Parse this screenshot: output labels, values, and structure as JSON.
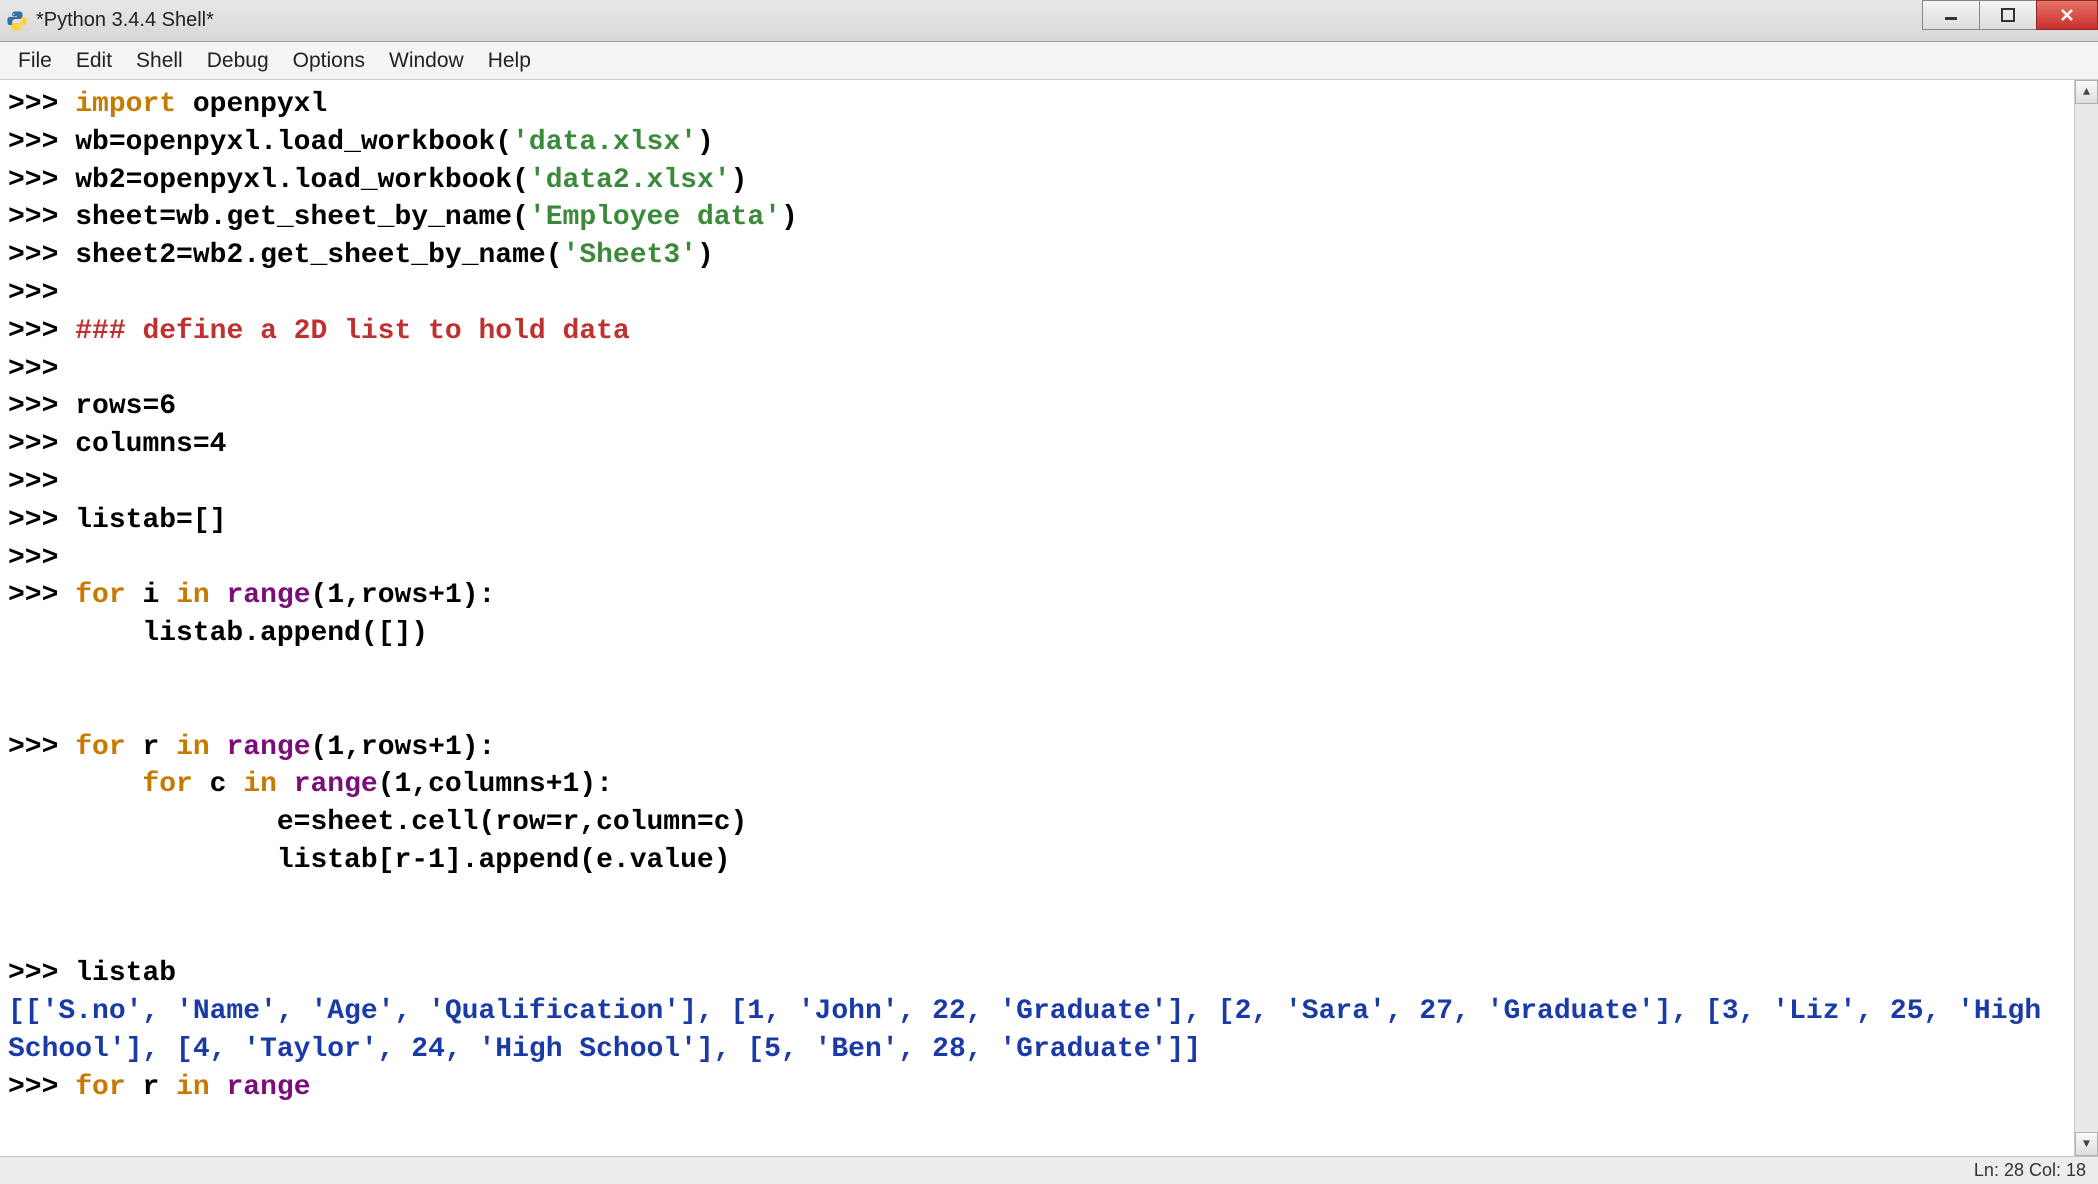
{
  "window": {
    "title": "*Python 3.4.4 Shell*"
  },
  "menu": {
    "file": "File",
    "edit": "Edit",
    "shell": "Shell",
    "debug": "Debug",
    "options": "Options",
    "window": "Window",
    "help": "Help"
  },
  "code": {
    "prompt": ">>>",
    "kw_import": "import",
    "l1_rest": " openpyxl",
    "l2": "wb=openpyxl.load_workbook(",
    "l2_str": "'data.xlsx'",
    "l2_end": ")",
    "l3": "wb2=openpyxl.load_workbook(",
    "l3_str": "'data2.xlsx'",
    "l3_end": ")",
    "l4": "sheet=wb.get_sheet_by_name(",
    "l4_str": "'Employee data'",
    "l4_end": ")",
    "l5": "sheet2=wb2.get_sheet_by_name(",
    "l5_str": "'Sheet3'",
    "l5_end": ")",
    "l7_cmt": "### define a 2D list to hold data",
    "l9": "rows=6",
    "l10": "columns=4",
    "l12": "listab=[]",
    "kw_for": "for",
    "kw_in": "in",
    "kw_range": "range",
    "l14_a": " i ",
    "l14_b": " ",
    "l14_c": "(1,rows+1):",
    "l15": "        listab.append([])",
    "l18_a": " r ",
    "l18_c": "(1,rows+1):",
    "l19_a": "        ",
    "l19_b": " c ",
    "l19_c": "(1,columns+1):",
    "l20": "                e=sheet.cell(row=r,column=c)",
    "l21": "                listab[r-1].append(e.value)",
    "l24": "listab",
    "l25_out": "[['S.no', 'Name', 'Age', 'Qualification'], [1, 'John', 22, 'Graduate'], [2, 'Sara', 27, 'Graduate'], [3, 'Liz', 25, 'High School'], [4, 'Taylor', 24, 'High School'], [5, 'Ben', 28, 'Graduate']]",
    "l26_a": " r ",
    "l26_b": " "
  },
  "status": {
    "text": "Ln: 28  Col: 18"
  }
}
